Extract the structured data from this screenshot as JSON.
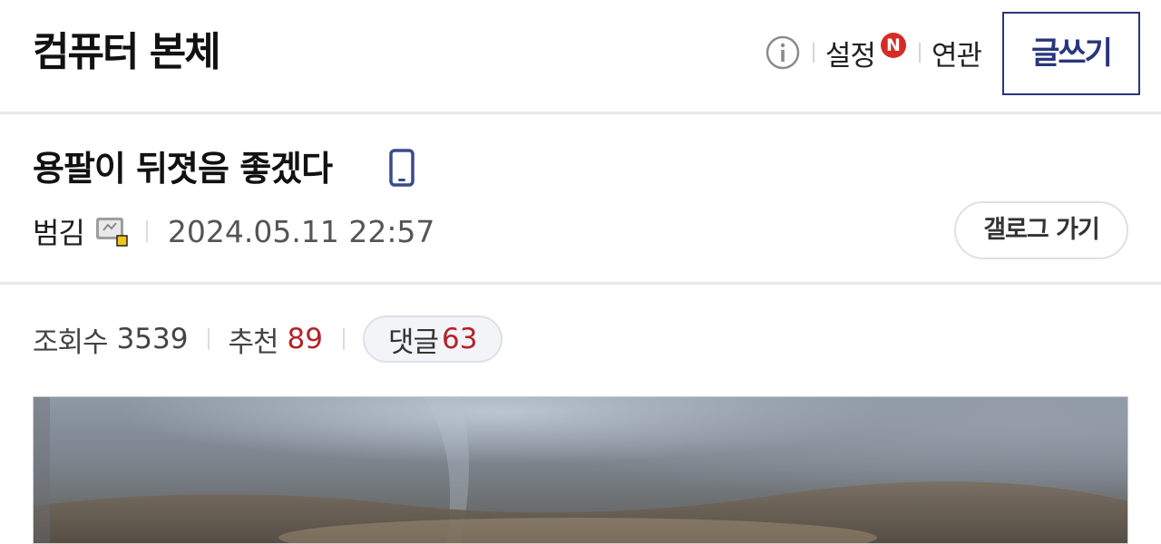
{
  "header": {
    "gallery_title": "컴퓨터 본체",
    "info_icon": "info-circle-icon",
    "settings_label": "설정",
    "new_badge": "N",
    "related_label": "연관",
    "write_label": "글쓰기"
  },
  "post": {
    "title": "용팔이 뒤졋음 좋겠다",
    "mobile_icon": "mobile-phone-icon",
    "writer": "범김",
    "writer_icon": "fixed-nick-icon",
    "date": "2024.05.11 22:57",
    "gallog_label": "갤로그 가기",
    "stats": {
      "views_label": "조회수",
      "views": "3539",
      "recommend_label": "추천",
      "recommend": "89",
      "comments_label": "댓글",
      "comments": "63"
    }
  },
  "colors": {
    "accent": "#29367c",
    "highlight_red": "#b4232a",
    "badge_red": "#d72a26",
    "divider": "#e6e8ec"
  }
}
